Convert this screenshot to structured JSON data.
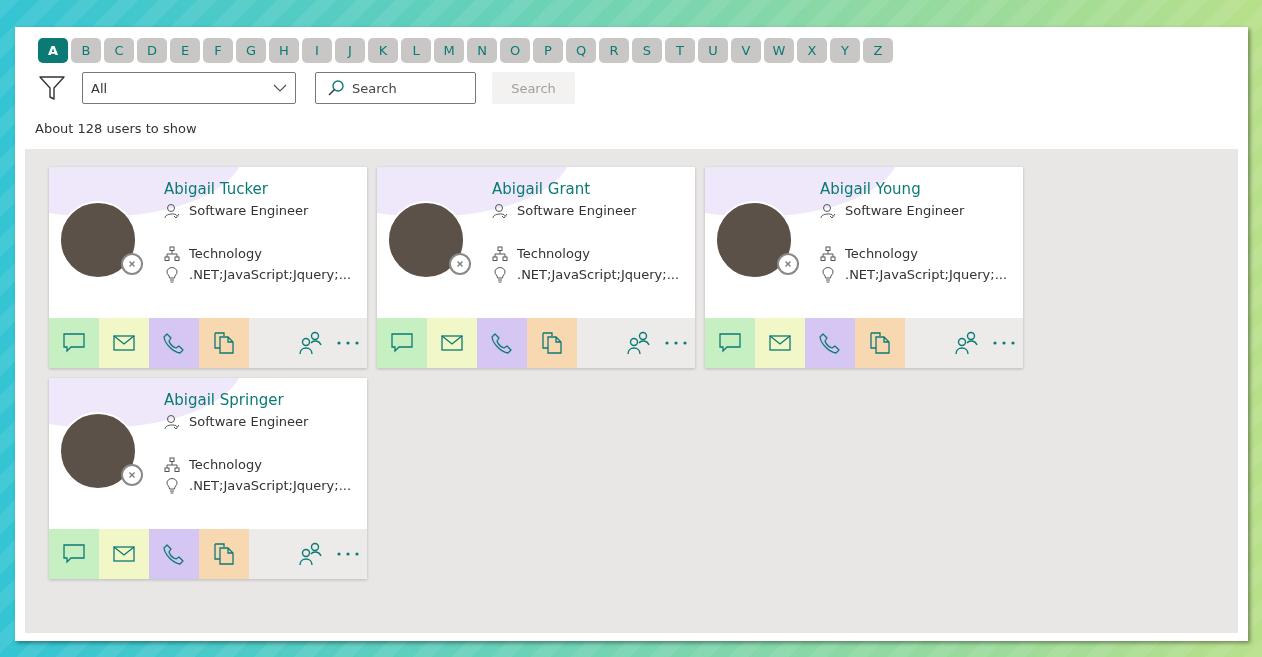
{
  "letters": [
    {
      "label": "A",
      "selected": true
    },
    {
      "label": "B",
      "selected": false
    },
    {
      "label": "C",
      "selected": false
    },
    {
      "label": "D",
      "selected": false
    },
    {
      "label": "E",
      "selected": false
    },
    {
      "label": "F",
      "selected": false
    },
    {
      "label": "G",
      "selected": false
    },
    {
      "label": "H",
      "selected": false
    },
    {
      "label": "I",
      "selected": false
    },
    {
      "label": "J",
      "selected": false
    },
    {
      "label": "K",
      "selected": false
    },
    {
      "label": "L",
      "selected": false
    },
    {
      "label": "M",
      "selected": false
    },
    {
      "label": "N",
      "selected": false
    },
    {
      "label": "O",
      "selected": false
    },
    {
      "label": "P",
      "selected": false
    },
    {
      "label": "Q",
      "selected": false
    },
    {
      "label": "R",
      "selected": false
    },
    {
      "label": "S",
      "selected": false
    },
    {
      "label": "T",
      "selected": false
    },
    {
      "label": "U",
      "selected": false
    },
    {
      "label": "V",
      "selected": false
    },
    {
      "label": "W",
      "selected": false
    },
    {
      "label": "X",
      "selected": false
    },
    {
      "label": "Y",
      "selected": false
    },
    {
      "label": "Z",
      "selected": false
    }
  ],
  "filter": {
    "value": "All"
  },
  "search": {
    "placeholder": "Search",
    "button": "Search"
  },
  "count": "About 128 users to show",
  "users": [
    {
      "name": "Abigail Tucker",
      "title": "Software Engineer",
      "department": "Technology",
      "skills": ".NET;JavaScript;Jquery;..."
    },
    {
      "name": "Abigail Grant",
      "title": "Software Engineer",
      "department": "Technology",
      "skills": ".NET;JavaScript;Jquery;..."
    },
    {
      "name": "Abigail Young",
      "title": "Software Engineer",
      "department": "Technology",
      "skills": ".NET;JavaScript;Jquery;..."
    },
    {
      "name": "Abigail Springer",
      "title": "Software Engineer",
      "department": "Technology",
      "skills": ".NET;JavaScript;Jquery;..."
    }
  ]
}
